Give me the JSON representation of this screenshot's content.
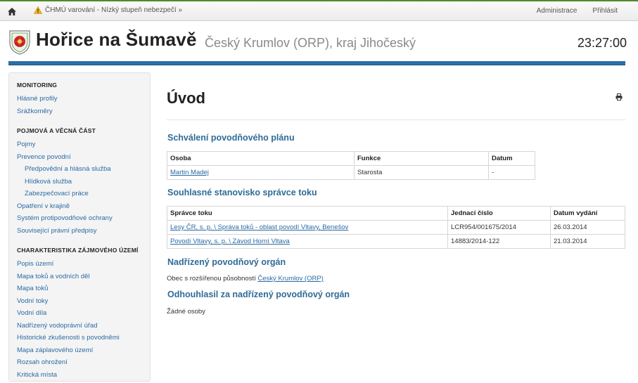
{
  "topbar": {
    "warning": "ČHMÚ varování - Nízký stupeň nebezpečí »",
    "admin": "Administrace",
    "login": "Přihlásit"
  },
  "header": {
    "title": "Hořice na Šumavě",
    "subtitle": "Český Krumlov (ORP), kraj Jihočeský",
    "time": "23:27:00"
  },
  "sidebar": {
    "sections": [
      {
        "title": "MONITORING",
        "items": [
          {
            "label": "Hlásné profily",
            "sub": false
          },
          {
            "label": "Srážkoměry",
            "sub": false
          }
        ]
      },
      {
        "title": "POJMOVÁ A VĚCNÁ ČÁST",
        "items": [
          {
            "label": "Pojmy",
            "sub": false
          },
          {
            "label": "Prevence povodní",
            "sub": false
          },
          {
            "label": "Předpovědní a hlásná služba",
            "sub": true
          },
          {
            "label": "Hlídková služba",
            "sub": true
          },
          {
            "label": "Zabezpečovací práce",
            "sub": true
          },
          {
            "label": "Opatření v krajině",
            "sub": false
          },
          {
            "label": "Systém protipovodňové ochrany",
            "sub": false
          },
          {
            "label": "Související právní předpisy",
            "sub": false
          }
        ]
      },
      {
        "title": "CHARAKTERISTIKA ZÁJMOVÉHO ÚZEMÍ",
        "items": [
          {
            "label": "Popis území",
            "sub": false
          },
          {
            "label": "Mapa toků a vodních děl",
            "sub": false
          },
          {
            "label": "Mapa toků",
            "sub": false
          },
          {
            "label": "Vodní toky",
            "sub": false
          },
          {
            "label": "Vodní díla",
            "sub": false
          },
          {
            "label": "Nadřízený vodoprávní úřad",
            "sub": false
          },
          {
            "label": "Historické zkušenosti s povodněmi",
            "sub": false
          },
          {
            "label": "Mapa záplavového území",
            "sub": false
          },
          {
            "label": "Rozsah ohrožení",
            "sub": false
          },
          {
            "label": "Kritická místa",
            "sub": false
          }
        ]
      }
    ]
  },
  "main": {
    "heading": "Úvod",
    "approval": {
      "title": "Schválení povodňového plánu",
      "headers": [
        "Osoba",
        "Funkce",
        "Datum"
      ],
      "rows": [
        [
          "Martin Madej",
          "Starosta",
          "-"
        ]
      ]
    },
    "consent": {
      "title": "Souhlasné stanovisko správce toku",
      "headers": [
        "Správce toku",
        "Jednací číslo",
        "Datum vydání"
      ],
      "rows": [
        [
          "Lesy ČR, s. p. \\ Správa toků - oblast povodí Vltavy, Benešov",
          "LCR954/001675/2014",
          "26.03.2014"
        ],
        [
          "Povodí Vltavy, s. p. \\ Závod Horní Vltava",
          "14883/2014-122",
          "21.03.2014"
        ]
      ]
    },
    "authority": {
      "title": "Nadřízený povodňový orgán",
      "prefix": "Obec s rozšířenou působností",
      "link": "Český Krumlov (ORP)"
    },
    "voted": {
      "title": "Odhouhlasil za nadřízený povodňový orgán",
      "text": "Žádné osoby"
    }
  }
}
